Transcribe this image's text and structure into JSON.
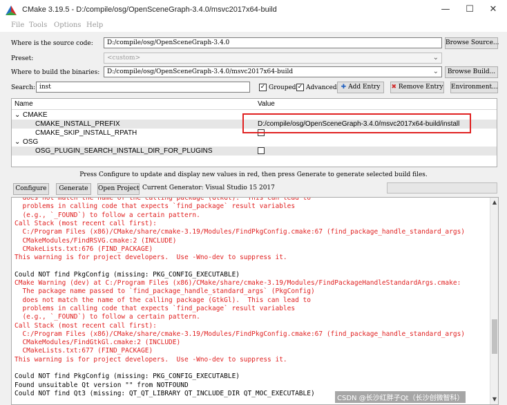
{
  "window": {
    "title": "CMake 3.19.5 - D:/compile/osg/OpenSceneGraph-3.4.0/msvc2017x64-build",
    "minimize_glyph": "—",
    "maximize_glyph": "☐",
    "close_glyph": "✕"
  },
  "menu": [
    "File",
    "Tools",
    "Options",
    "Help"
  ],
  "source": {
    "label": "Where is the source code:",
    "value": "D:/compile/osg/OpenSceneGraph-3.4.0",
    "button": "Browse Source..."
  },
  "preset": {
    "label": "Preset:",
    "value": "<custom>"
  },
  "build": {
    "label": "Where to build the binaries:",
    "value": "D:/compile/osg/OpenSceneGraph-3.4.0/msvc2017x64-build",
    "button": "Browse Build..."
  },
  "search": {
    "label": "Search:",
    "value": "inst",
    "grouped_label": "Grouped",
    "grouped_checked": true,
    "advanced_label": "Advanced",
    "advanced_checked": true,
    "add_entry": "Add Entry",
    "remove_entry": "Remove Entry",
    "environment": "Environment..."
  },
  "tree": {
    "col_name": "Name",
    "col_value": "Value",
    "rows": [
      {
        "indent": 0,
        "name": "CMAKE",
        "expanded": true,
        "value": "",
        "checkbox": false,
        "shade": false
      },
      {
        "indent": 1,
        "name": "CMAKE_INSTALL_PREFIX",
        "value": "D:/compile/osg/OpenSceneGraph-3.4.0/msvc2017x64-build/install",
        "checkbox": false,
        "shade": true
      },
      {
        "indent": 1,
        "name": "CMAKE_SKIP_INSTALL_RPATH",
        "value": "",
        "checkbox": true,
        "shade": false
      },
      {
        "indent": 0,
        "name": "OSG",
        "expanded": true,
        "value": "",
        "checkbox": false,
        "shade": false
      },
      {
        "indent": 1,
        "name": "OSG_PLUGIN_SEARCH_INSTALL_DIR_FOR_PLUGINS",
        "value": "",
        "checkbox": true,
        "shade": true
      }
    ]
  },
  "hint": "Press Configure to update and display new values in red, then press Generate to generate selected build files.",
  "actions": {
    "configure": "Configure",
    "generate": "Generate",
    "open_project": "Open Project",
    "generator_label": "Current Generator: Visual Studio 15 2017"
  },
  "log": [
    {
      "text": "  does not match the name of the calling package (GtkGl).  This can lead to",
      "color": "red"
    },
    {
      "text": "  problems in calling code that expects `find_package` result variables",
      "color": "red"
    },
    {
      "text": "  (e.g., `_FOUND`) to follow a certain pattern.",
      "color": "red"
    },
    {
      "text": "Call Stack (most recent call first):",
      "color": "red"
    },
    {
      "text": "  C:/Program Files (x86)/CMake/share/cmake-3.19/Modules/FindPkgConfig.cmake:67 (find_package_handle_standard_args)",
      "color": "red"
    },
    {
      "text": "  CMakeModules/FindRSVG.cmake:2 (INCLUDE)",
      "color": "red"
    },
    {
      "text": "  CMakeLists.txt:676 (FIND_PACKAGE)",
      "color": "red"
    },
    {
      "text": "This warning is for project developers.  Use -Wno-dev to suppress it.",
      "color": "red"
    },
    {
      "text": "",
      "color": "black"
    },
    {
      "text": "Could NOT find PkgConfig (missing: PKG_CONFIG_EXECUTABLE)",
      "color": "black"
    },
    {
      "text": "CMake Warning (dev) at C:/Program Files (x86)/CMake/share/cmake-3.19/Modules/FindPackageHandleStandardArgs.cmake:",
      "color": "red"
    },
    {
      "text": "  The package name passed to `find_package_handle_standard_args` (PkgConfig)",
      "color": "red"
    },
    {
      "text": "  does not match the name of the calling package (GtkGl).  This can lead to",
      "color": "red"
    },
    {
      "text": "  problems in calling code that expects `find_package` result variables",
      "color": "red"
    },
    {
      "text": "  (e.g., `_FOUND`) to follow a certain pattern.",
      "color": "red"
    },
    {
      "text": "Call Stack (most recent call first):",
      "color": "red"
    },
    {
      "text": "  C:/Program Files (x86)/CMake/share/cmake-3.19/Modules/FindPkgConfig.cmake:67 (find_package_handle_standard_args)",
      "color": "red"
    },
    {
      "text": "  CMakeModules/FindGtkGl.cmake:2 (INCLUDE)",
      "color": "red"
    },
    {
      "text": "  CMakeLists.txt:677 (FIND_PACKAGE)",
      "color": "red"
    },
    {
      "text": "This warning is for project developers.  Use -Wno-dev to suppress it.",
      "color": "red"
    },
    {
      "text": "",
      "color": "black"
    },
    {
      "text": "Could NOT find PkgConfig (missing: PKG_CONFIG_EXECUTABLE)",
      "color": "black"
    },
    {
      "text": "Found unsuitable Qt version \"\" from NOTFOUND",
      "color": "black"
    },
    {
      "text": "Could NOT find Qt3 (missing: QT_QT_LIBRARY QT_INCLUDE_DIR QT_MOC_EXECUTABLE)",
      "color": "black"
    }
  ],
  "watermark": "CSDN @长沙红胖子Qt（长沙创微智科）"
}
